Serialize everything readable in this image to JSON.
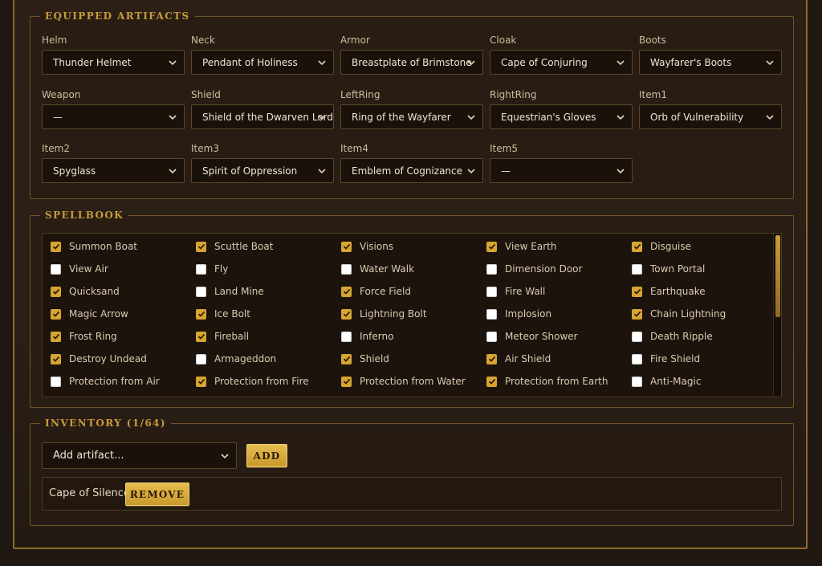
{
  "equipped": {
    "legend": "EQUIPPED ARTIFACTS",
    "slots": [
      {
        "label": "Helm",
        "value": "Thunder Helmet"
      },
      {
        "label": "Neck",
        "value": "Pendant of Holiness"
      },
      {
        "label": "Armor",
        "value": "Breastplate of Brimstone"
      },
      {
        "label": "Cloak",
        "value": "Cape of Conjuring"
      },
      {
        "label": "Boots",
        "value": "Wayfarer's Boots"
      },
      {
        "label": "Weapon",
        "value": "—"
      },
      {
        "label": "Shield",
        "value": "Shield of the Dwarven Lords"
      },
      {
        "label": "LeftRing",
        "value": "Ring of the Wayfarer"
      },
      {
        "label": "RightRing",
        "value": "Equestrian's Gloves"
      },
      {
        "label": "Item1",
        "value": "Orb of Vulnerability"
      },
      {
        "label": "Item2",
        "value": "Spyglass"
      },
      {
        "label": "Item3",
        "value": "Spirit of Oppression"
      },
      {
        "label": "Item4",
        "value": "Emblem of Cognizance"
      },
      {
        "label": "Item5",
        "value": "—"
      }
    ]
  },
  "spellbook": {
    "legend": "SPELLBOOK",
    "spells": [
      {
        "name": "Summon Boat",
        "checked": true
      },
      {
        "name": "Scuttle Boat",
        "checked": true
      },
      {
        "name": "Visions",
        "checked": true
      },
      {
        "name": "View Earth",
        "checked": true
      },
      {
        "name": "Disguise",
        "checked": true
      },
      {
        "name": "View Air",
        "checked": false
      },
      {
        "name": "Fly",
        "checked": false
      },
      {
        "name": "Water Walk",
        "checked": false
      },
      {
        "name": "Dimension Door",
        "checked": false
      },
      {
        "name": "Town Portal",
        "checked": false
      },
      {
        "name": "Quicksand",
        "checked": true
      },
      {
        "name": "Land Mine",
        "checked": false
      },
      {
        "name": "Force Field",
        "checked": true
      },
      {
        "name": "Fire Wall",
        "checked": false
      },
      {
        "name": "Earthquake",
        "checked": true
      },
      {
        "name": "Magic Arrow",
        "checked": true
      },
      {
        "name": "Ice Bolt",
        "checked": true
      },
      {
        "name": "Lightning Bolt",
        "checked": true
      },
      {
        "name": "Implosion",
        "checked": false
      },
      {
        "name": "Chain Lightning",
        "checked": true
      },
      {
        "name": "Frost Ring",
        "checked": true
      },
      {
        "name": "Fireball",
        "checked": true
      },
      {
        "name": "Inferno",
        "checked": false
      },
      {
        "name": "Meteor Shower",
        "checked": false
      },
      {
        "name": "Death Ripple",
        "checked": false
      },
      {
        "name": "Destroy Undead",
        "checked": true
      },
      {
        "name": "Armageddon",
        "checked": false
      },
      {
        "name": "Shield",
        "checked": true
      },
      {
        "name": "Air Shield",
        "checked": true
      },
      {
        "name": "Fire Shield",
        "checked": false
      },
      {
        "name": "Protection from Air",
        "checked": false
      },
      {
        "name": "Protection from Fire",
        "checked": true
      },
      {
        "name": "Protection from Water",
        "checked": true
      },
      {
        "name": "Protection from Earth",
        "checked": true
      },
      {
        "name": "Anti-Magic",
        "checked": false
      }
    ]
  },
  "inventory": {
    "legend": "INVENTORY (1/64)",
    "add_select_value": "Add artifact...",
    "add_button": "ADD",
    "items": [
      {
        "name": "Cape of Silence",
        "remove_label": "REMOVE"
      }
    ]
  },
  "colors": {
    "accent_gold": "#c99b3a",
    "checkbox_checked": "#d7a531",
    "panel_bg": "#2a1f16"
  }
}
